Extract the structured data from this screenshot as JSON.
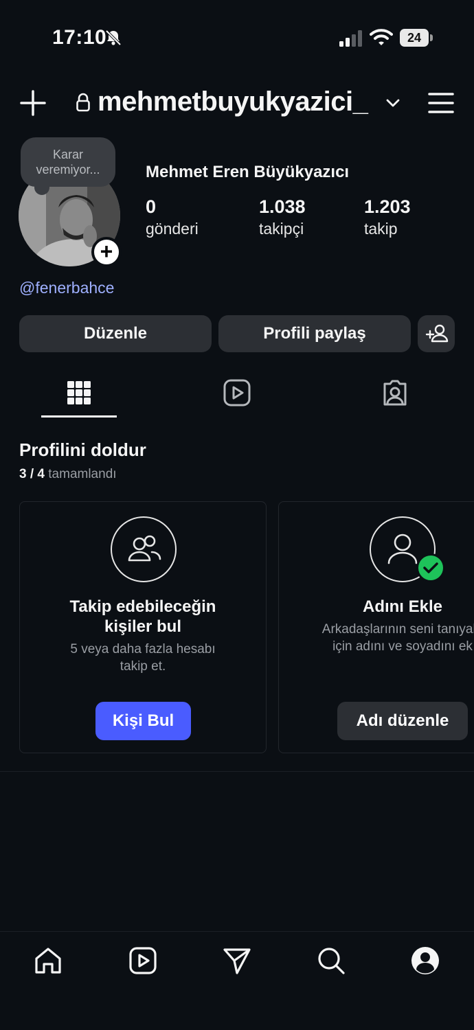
{
  "status_bar": {
    "time": "17:10",
    "battery": "24"
  },
  "header": {
    "username": "mehmetbuyukyazici_"
  },
  "profile": {
    "note": "Karar veremiyor...",
    "full_name": "Mehmet Eren Büyükyazıcı",
    "mention": "@fenerbahce",
    "stats": [
      {
        "value": "0",
        "label": "gönderi"
      },
      {
        "value": "1.038",
        "label": "takipçi"
      },
      {
        "value": "1.203",
        "label": "takip"
      }
    ]
  },
  "actions": {
    "edit": "Düzenle",
    "share": "Profili paylaş"
  },
  "complete_profile": {
    "title": "Profilini doldur",
    "progress_count": "3 / 4",
    "progress_text": "tamamlandı",
    "cards": [
      {
        "title_line1": "Takip edebileceğin",
        "title_line2": "kişiler bul",
        "desc_line1": "5 veya daha fazla hesabı",
        "desc_line2": "takip et.",
        "button": "Kişi Bul"
      },
      {
        "title_line1": "Adını Ekle",
        "desc_line1": "Arkadaşlarının seni tanıyabi",
        "desc_line2": "için adını ve soyadını ek",
        "button": "Adı düzenle"
      }
    ]
  },
  "colors": {
    "background": "#0b0f14",
    "accent": "#4a5cff",
    "mention": "#9fb0ff",
    "check": "#1ec25a"
  }
}
